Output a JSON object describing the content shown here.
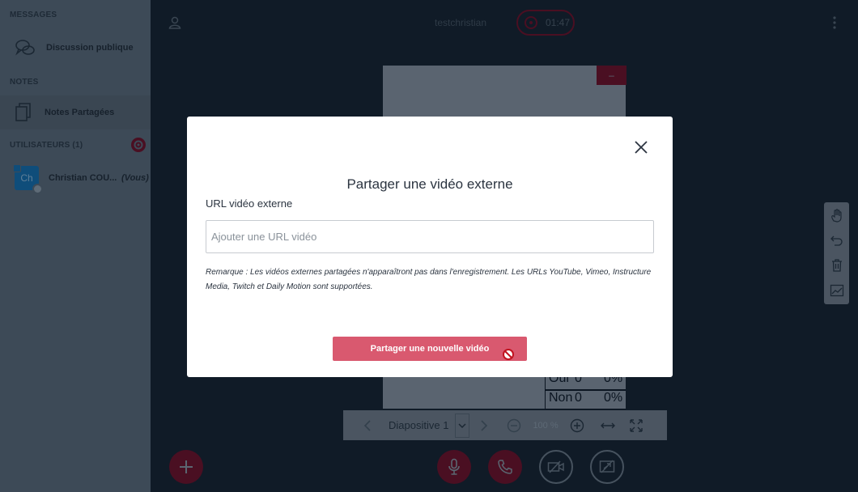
{
  "sidebar": {
    "messages_header": "MESSAGES",
    "public_chat": "Discussion publique",
    "notes_header": "NOTES",
    "shared_notes": "Notes Partagées",
    "users_header": "UTILISATEURS (1)",
    "user_avatar": "Ch",
    "user_name": "Christian COU...",
    "user_you": "(Vous)"
  },
  "topbar": {
    "meeting_title": "testchristian",
    "record_time": "01:47"
  },
  "presentation": {
    "slide_label": "Diapositive 1",
    "zoom": "100 %",
    "table_rows": [
      {
        "label": "Oui",
        "count": "0",
        "pct": "0%"
      },
      {
        "label": "Non",
        "count": "0",
        "pct": "0%"
      }
    ]
  },
  "modal": {
    "title": "Partager une vidéo externe",
    "url_label": "URL vidéo externe",
    "url_placeholder": "Ajouter une URL vidéo",
    "url_value": "",
    "note": "Remarque : Les vidéos externes partagées n'apparaîtront pas dans l'enregistrement. Les URLs YouTube, Vimeo, Instructure Media, Twitch et Daily Motion sont supportées.",
    "share_button": "Partager une nouvelle vidéo"
  },
  "colors": {
    "accent": "#d9596f",
    "dark_red": "#4a0f22",
    "sidebar": "#3d4a57",
    "main_bg": "#101b27"
  },
  "icons": [
    "user-icon",
    "chat-icon",
    "notes-icon",
    "gear-icon",
    "kebab-icon",
    "close-icon",
    "hand-icon",
    "undo-icon",
    "trash-icon",
    "chart-icon",
    "plus-icon",
    "mic-icon",
    "phone-icon",
    "camera-off-icon",
    "screenshare-icon",
    "no-entry-icon"
  ]
}
